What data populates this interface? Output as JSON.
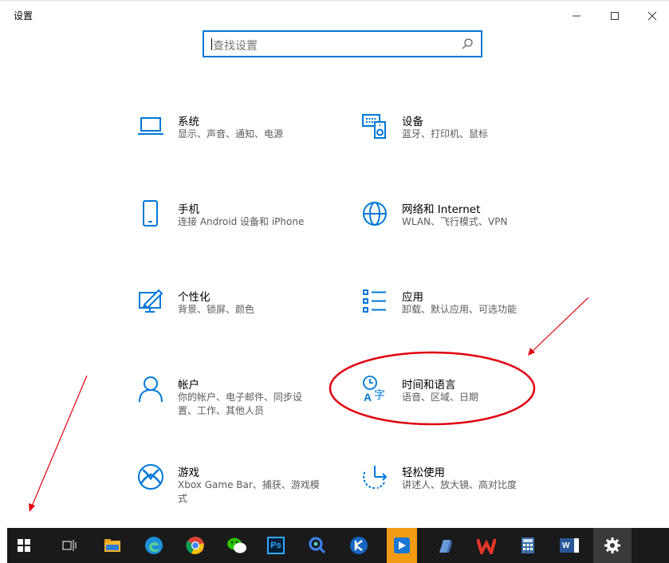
{
  "window": {
    "title": "设置",
    "minimize_glyph": "—",
    "maximize_glyph": "☐",
    "close_glyph": "✕"
  },
  "search": {
    "placeholder": "查找设置",
    "icon": "search-icon"
  },
  "tiles": [
    {
      "name": "系统",
      "desc": "显示、声音、通知、电源",
      "icon": "laptop-icon"
    },
    {
      "name": "设备",
      "desc": "蓝牙、打印机、鼠标",
      "icon": "keyboard-speaker-icon"
    },
    {
      "name": "手机",
      "desc": "连接 Android 设备和 iPhone",
      "icon": "phone-icon"
    },
    {
      "name": "网络和 Internet",
      "desc": "WLAN、飞行模式、VPN",
      "icon": "globe-icon"
    },
    {
      "name": "个性化",
      "desc": "背景、锁屏、颜色",
      "icon": "paint-monitor-icon"
    },
    {
      "name": "应用",
      "desc": "卸载、默认应用、可选功能",
      "icon": "app-list-icon"
    },
    {
      "name": "帐户",
      "desc": "你的帐户、电子邮件、同步设置、工作、其他人员",
      "icon": "person-icon"
    },
    {
      "name": "时间和语言",
      "desc": "语音、区域、日期",
      "icon": "time-language-icon"
    },
    {
      "name": "游戏",
      "desc": "Xbox Game Bar、捕获、游戏模式",
      "icon": "xbox-icon"
    },
    {
      "name": "轻松使用",
      "desc": "讲述人、放大镜、高对比度",
      "icon": "ease-of-access-icon"
    }
  ],
  "taskbar": {
    "ps_label": "Ps",
    "word_label": "W",
    "items": [
      "windows-start-icon",
      "task-view-icon",
      "file-explorer-icon",
      "edge-icon",
      "chrome-icon",
      "wechat-icon",
      "photoshop-icon",
      "search-app-icon",
      "kingsoft-icon",
      "blue-app-icon",
      "pen-app-icon",
      "wps-icon",
      "calculator-icon",
      "word-icon",
      "settings-gear-icon"
    ]
  },
  "colors": {
    "accent": "#0078d7",
    "annotation_red": "#e0000f",
    "taskbar_bg": "#1a1a1a"
  }
}
